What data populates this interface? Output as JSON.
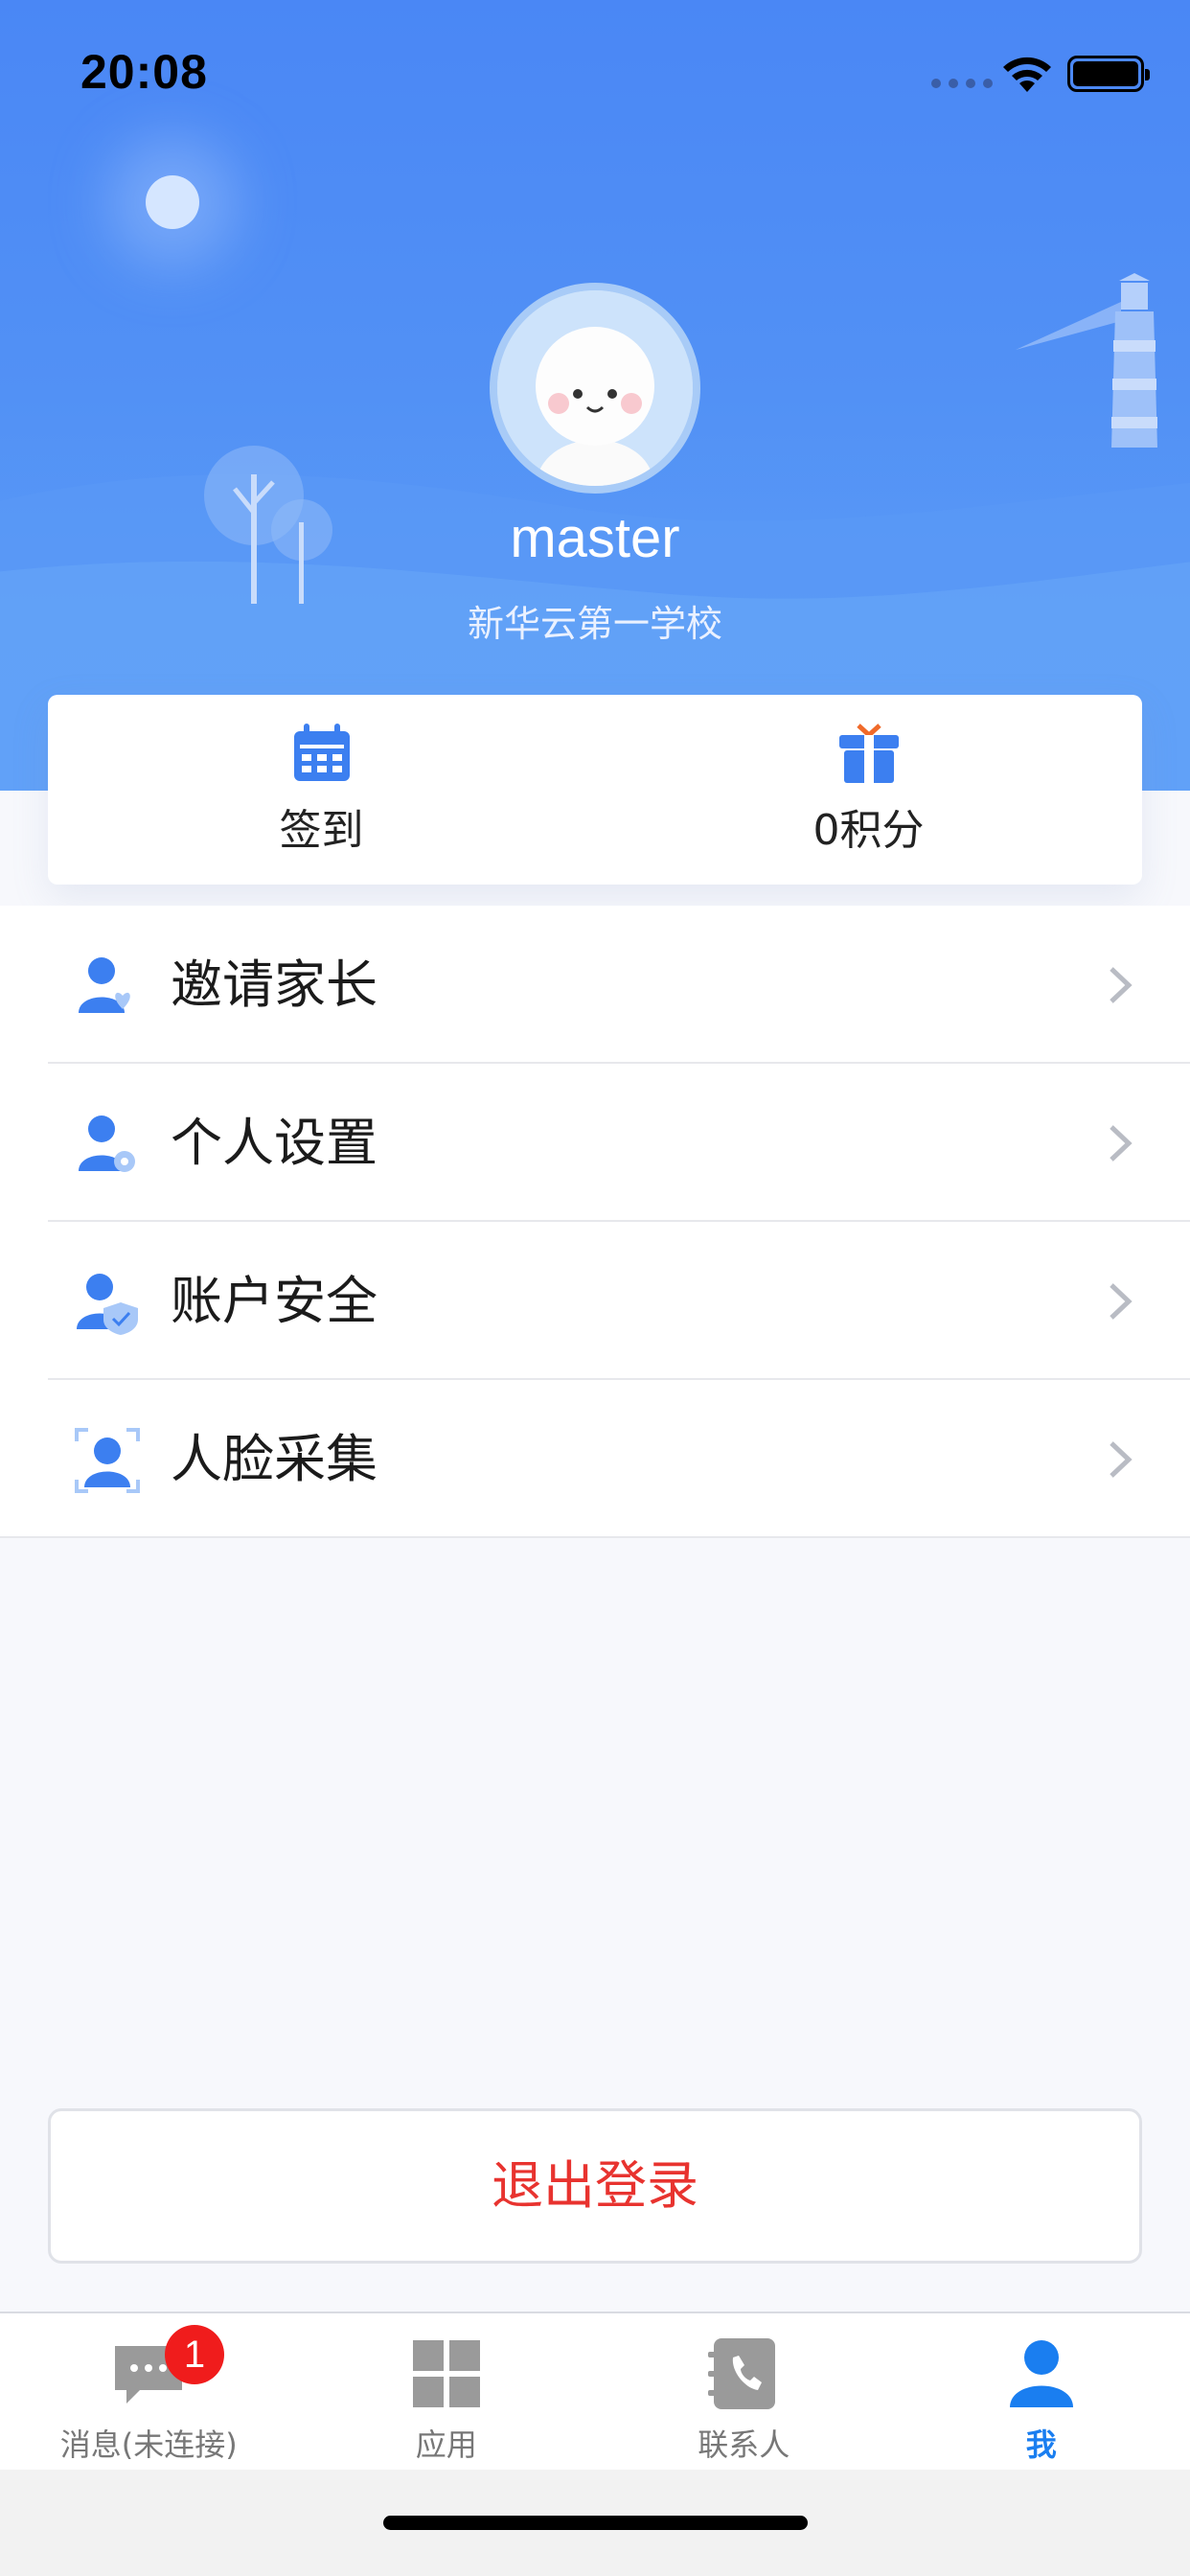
{
  "status_bar": {
    "time": "20:08"
  },
  "profile": {
    "username": "master",
    "school": "新华云第一学校"
  },
  "quick_actions": [
    {
      "label": "签到",
      "icon": "calendar-icon"
    },
    {
      "label": "0积分",
      "icon": "gift-icon"
    }
  ],
  "menu": [
    {
      "label": "邀请家长",
      "icon": "invite-parent-icon"
    },
    {
      "label": "个人设置",
      "icon": "user-settings-icon"
    },
    {
      "label": "账户安全",
      "icon": "account-security-icon"
    },
    {
      "label": "人脸采集",
      "icon": "face-capture-icon"
    }
  ],
  "logout_label": "退出登录",
  "tabs": [
    {
      "label": "消息(未连接)",
      "icon": "chat-icon",
      "badge": "1"
    },
    {
      "label": "应用",
      "icon": "apps-grid-icon"
    },
    {
      "label": "联系人",
      "icon": "contacts-phone-icon"
    },
    {
      "label": "我",
      "icon": "me-person-icon",
      "active": true
    }
  ],
  "colors": {
    "primary": "#4a87f5",
    "tab_active": "#1a7ef0",
    "logout": "#e8332f",
    "badge": "#f01c1c"
  }
}
